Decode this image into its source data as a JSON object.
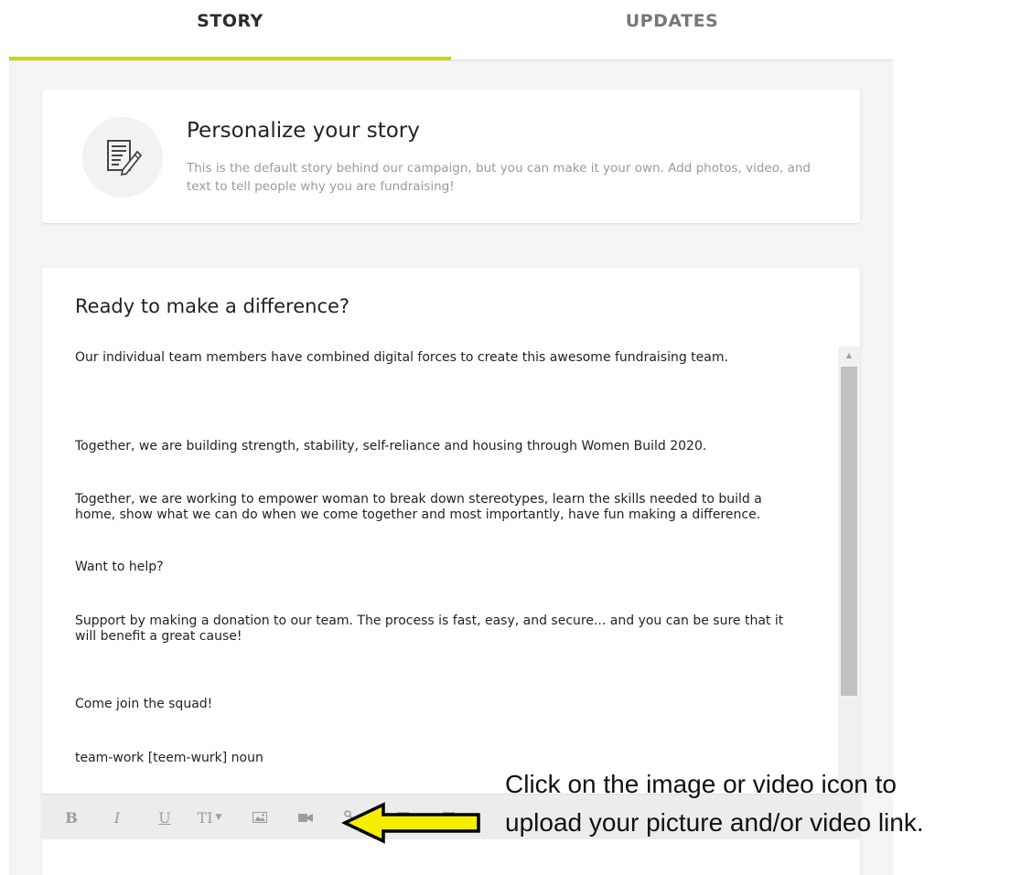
{
  "tabs": [
    {
      "label": "STORY",
      "active": true
    },
    {
      "label": "UPDATES",
      "active": false
    }
  ],
  "colors": {
    "accent": "#c6d31f",
    "arrow_fill": "#f5ee00"
  },
  "personalize": {
    "icon": "document-edit-icon",
    "title": "Personalize your story",
    "description": "This is the default story behind our campaign, but you can make it your own. Add photos, video, and text to tell people why you are fundraising!"
  },
  "story": {
    "title": "Ready to make a difference?",
    "paragraphs": [
      "Our individual team members have combined digital forces to create this awesome fundraising team.",
      "Together, we are building strength, stability, self-reliance and housing through Women Build 2020.",
      "Together, we are working to empower woman to break down stereotypes, learn the skills needed to build a home, show what we can do when we come together and most importantly, have fun making a difference.",
      "Want to help?",
      "Support by making a donation to our team. The process is fast, easy, and secure... and you can be sure that it will benefit a great cause!",
      "Come join the squad!",
      "team-work [teem-wurk] noun"
    ]
  },
  "toolbar": {
    "bold": "B",
    "italic": "I",
    "underline": "U",
    "text_size": "TI"
  },
  "annotation": {
    "line1": "Click on the image or video icon to",
    "line2": "upload your picture and/or video link."
  }
}
